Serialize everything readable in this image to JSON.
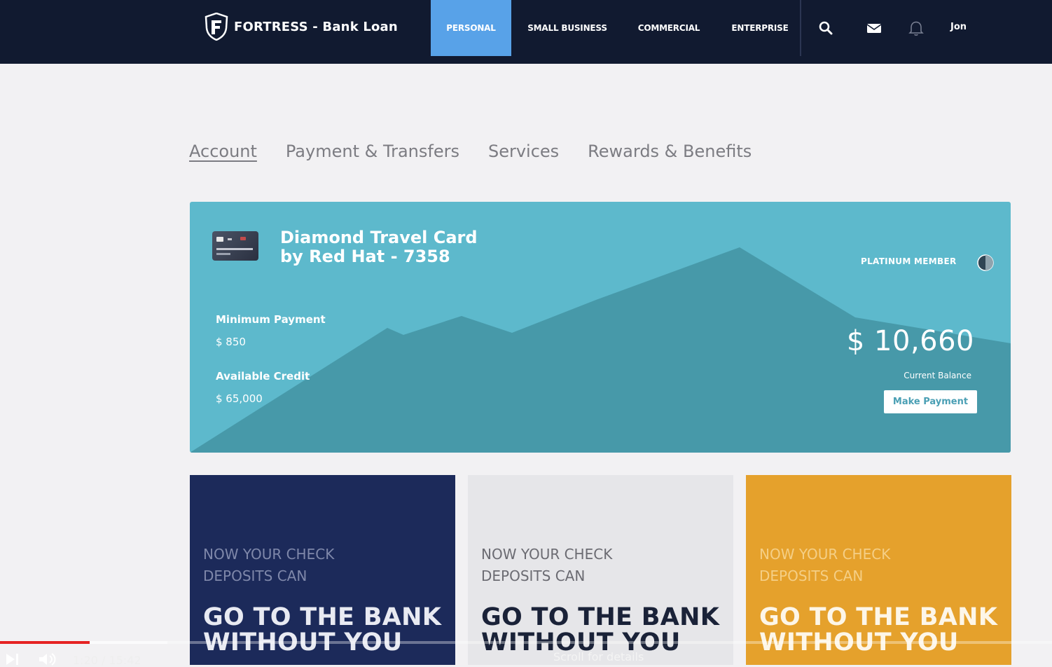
{
  "header": {
    "brand": "FORTRESS - Bank Loan",
    "nav": [
      "PERSONAL",
      "SMALL BUSINESS",
      "COMMERCIAL",
      "ENTERPRISE"
    ],
    "active_nav": "PERSONAL",
    "user": "Jon",
    "icons": [
      "search-icon",
      "mail-icon",
      "bell-icon"
    ]
  },
  "tabs": [
    "Account",
    "Payment & Transfers",
    "Services",
    "Rewards & Benefits"
  ],
  "active_tab": "Account",
  "card": {
    "title_line1": "Diamond Travel Card",
    "title_line2": "by Red Hat - 7358",
    "min_payment_label": "Minimum Payment",
    "min_payment_value": "$ 850",
    "credit_label": "Available Credit",
    "credit_value": "$ 65,000",
    "tier": "PLATINUM MEMBER",
    "balance": "$ 10,660",
    "balance_label": "Current Balance",
    "pay_button": "Make Payment",
    "colors": {
      "background": "#5db9cc",
      "mountain": "#4799a9"
    }
  },
  "promos": [
    {
      "small_line1": "NOW YOUR CHECK",
      "small_line2": "DEPOSITS CAN",
      "big_line1": "GO TO THE BANK",
      "big_line2": "WITHOUT YOU",
      "bg": "#1c2a5a"
    },
    {
      "small_line1": "NOW YOUR CHECK",
      "small_line2": "DEPOSITS CAN",
      "big_line1": "GO TO THE BANK",
      "big_line2": "WITHOUT YOU",
      "bg": "#e6e6e9"
    },
    {
      "small_line1": "NOW YOUR CHECK",
      "small_line2": "DEPOSITS CAN",
      "big_line1": "GO TO THE BANK",
      "big_line2": "WITHOUT YOU",
      "bg": "#e5a12c"
    }
  ],
  "video": {
    "time": "1:20 / 15:42",
    "scroll_hint": "Scroll for details",
    "progress_fraction": 0.085,
    "buffered_fraction": 0.159,
    "accent": "#e52323"
  }
}
